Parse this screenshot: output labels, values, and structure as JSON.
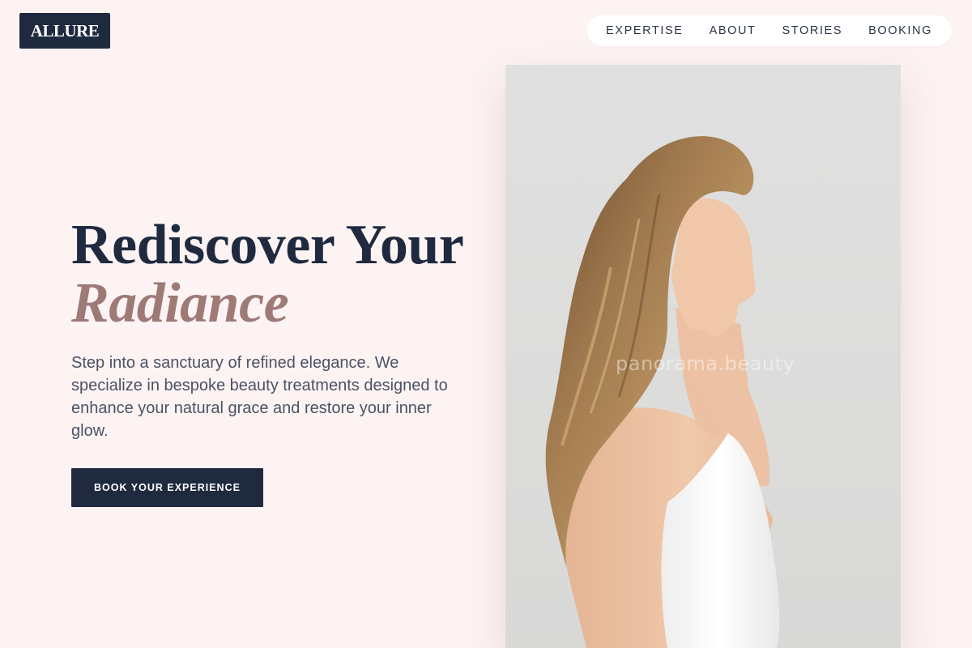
{
  "brand": {
    "logo_text": "ALLURE"
  },
  "nav": {
    "items": [
      {
        "label": "EXPERTISE"
      },
      {
        "label": "ABOUT"
      },
      {
        "label": "STORIES"
      },
      {
        "label": "BOOKING"
      }
    ]
  },
  "hero": {
    "title_line1": "Rediscover Your",
    "title_line2": "Radiance",
    "description": "Step into a sanctuary of refined elegance. We specialize in bespoke beauty treatments designed to enhance your natural grace and restore your inner glow.",
    "cta_label": "BOOK YOUR EXPERIENCE"
  },
  "photo": {
    "watermark": "panorama.beauty"
  },
  "colors": {
    "background": "#fdf3f3",
    "navy": "#1f2a3f",
    "accent_mauve": "#9e7a77",
    "body_text": "#4a5263"
  }
}
